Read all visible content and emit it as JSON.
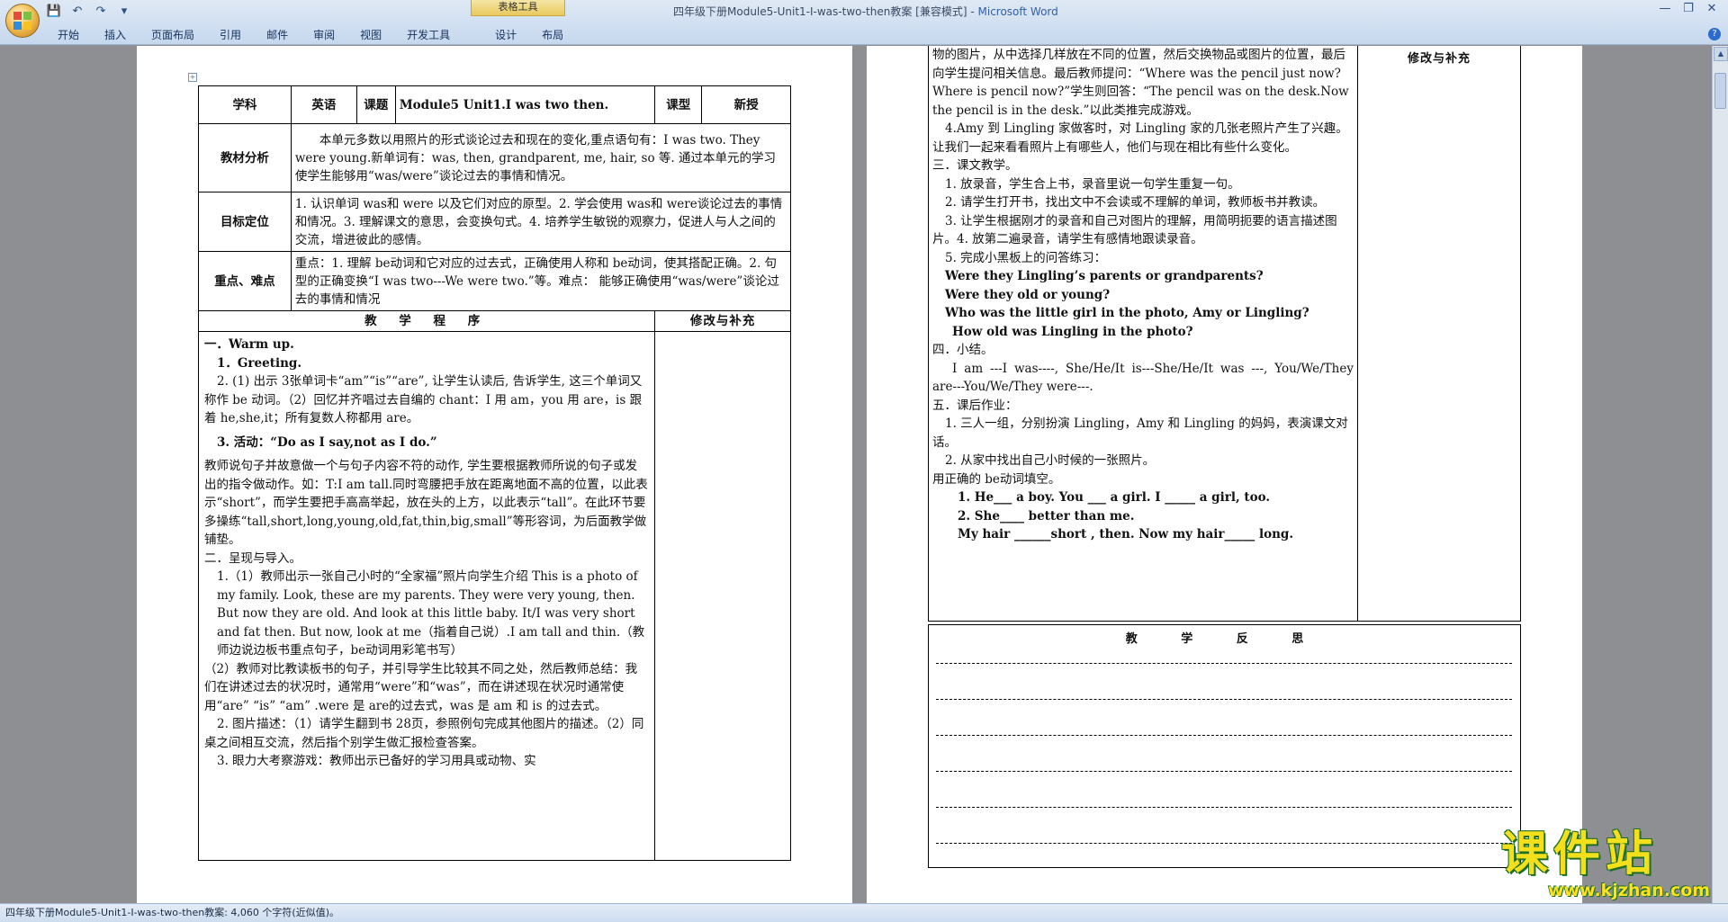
{
  "window": {
    "title": "四年级下册Module5-Unit1-I-was-two-then教案 [兼容模式]",
    "app_name": "Microsoft Word",
    "contextual_tab": "表格工具"
  },
  "ribbon": {
    "tabs": [
      "开始",
      "插入",
      "页面布局",
      "引用",
      "邮件",
      "审阅",
      "视图",
      "开发工具",
      "设计",
      "布局"
    ]
  },
  "quick_access": {
    "save": "💾",
    "undo": "↶",
    "redo": "↷",
    "customize": "▾"
  },
  "window_controls": {
    "minimize": "—",
    "restore": "❐",
    "close": "✕",
    "help": "?"
  },
  "table": {
    "subject_label": "学科",
    "subject_value": "英语",
    "topic_label": "课题",
    "topic_value": "Module5 Unit1.I was two then.",
    "type_label": "课型",
    "type_value": "新授",
    "analysis_label": "教材分析",
    "analysis_text": "本单元多数以用照片的形式谈论过去和现在的变化,重点语句有：I was two. They were young.新单词有：was, then, grandparent, me, hair, so 等. 通过本单元的学习使学生能够用“was/were”谈论过去的事情和情况。",
    "goal_label": "目标定位",
    "goal_text": "1. 认识单词 was和 were 以及它们对应的原型。2. 学会使用 was和 were谈论过去的事情和情况。3. 理解课文的意思，会变换句式。4. 培养学生敏锐的观察力，促进人与人之间的交流，增进彼此的感情。",
    "key_label": "重点、难点",
    "key_text": "重点：1. 理解 be动词和它对应的过去式，正确使用人称和 be动词，使其搭配正确。2. 句型的正确变换“I was two---We were two.”等。难点： 能够正确使用“was/were”谈论过去的事情和情况",
    "procedure_header": "教 学 程 序",
    "supplement_header": "修改与补充"
  },
  "procedure_left": [
    "一．Warm up.",
    "1．Greeting.",
    "2. (1) 出示 3张单词卡“am”“is”“are”, 让学生认读后, 告诉学生, 这三个单词又称作 be 动词。（2）回忆并齐唱过去自编的 chant：I 用 am，you 用 are，is 跟着 he,she,it；所有复数人称都用 are。",
    "3. 活动：“Do as I say,not as I do.”",
    "教师说句子并故意做一个与句子内容不符的动作, 学生要根据教师所说的句子或发出的指令做动作。如：T:I am tall.同时弯腰把手放在距离地面不高的位置，以此表示“short”，而学生要把手高高举起，放在头的上方，以此表示“tall”。在此环节要多操练“tall,short,long,young,old,fat,thin,big,small”等形容词，为后面教学做铺垫。",
    "二．呈现与导入。",
    "1.（1）教师出示一张自己小时的“全家福”照片向学生介绍 This is a photo of my family. Look, these are my parents. They were very young, then. But now they are old. And look at this little baby. It/I was very short and fat then. But now, look at me（指着自己说）.I am tall and thin.（教师边说边板书重点句子，be动词用彩笔书写）",
    "（2）教师对比教读板书的句子，并引导学生比较其不同之处，然后教师总结：我们在讲述过去的状况时，通常用“were”和“was”，而在讲述现在状况时通常使用“are” “is” “am” .were 是 are的过去式，was 是 am 和 is 的过去式。",
    "2. 图片描述：（1）请学生翻到书 28页，参照例句完成其他图片的描述。（2）同桌之间相互交流，然后指个别学生做汇报检查答案。",
    "3. 眼力大考察游戏：教师出示已备好的学习用具或动物、实"
  ],
  "procedure_right": [
    "物的图片，从中选择几样放在不同的位置，然后交换物品或图片的位置，最后向学生提问相关信息。最后教师提问：“Where was the pencil just now?Where is pencil now?”学生则回答：“The pencil was on the desk.Now the pencil is in the desk.”以此类推完成游戏。",
    "4.Amy 到 Lingling 家做客时，对 Lingling 家的几张老照片产生了兴趣。让我们一起来看看照片上有哪些人，他们与现在相比有些什么变化。",
    "三．课文教学。",
    "1. 放录音，学生合上书，录音里说一句学生重复一句。",
    "2. 请学生打开书，找出文中不会读或不理解的单词，教师板书并教读。",
    "3. 让学生根据刚才的录音和自己对图片的理解，用简明扼要的语言描述图片。4. 放第二遍录音，请学生有感情地跟读录音。",
    "5. 完成小黑板上的问答练习：",
    "Were they Lingling’s parents or grandparents?",
    "Were they old or young?",
    "Who was the little girl in the photo, Amy or Lingling?",
    "How old was Lingling in the photo?",
    "四．小结。",
    "I am ---I was----, She/He/It is---She/He/It was ---, You/We/They are---You/We/They were---.",
    "五．课后作业：",
    "1. 三人一组，分别扮演 Lingling，Amy 和 Lingling 的妈妈，表演课文对话。",
    "2. 从家中找出自己小时候的一张照片。",
    "用正确的 be动词填空。",
    "1. He___ a boy. You ___ a girl. I _____ a girl, too.",
    "2. She____ better than me.",
    "My hair ______short , then. Now my hair_____ long."
  ],
  "right_supplement_header": "修改与补充",
  "reflection_header": "教 学 反 思",
  "status_bar": "四年级下册Module5-Unit1-I-was-two-then教案: 4,060 个字符(近似值)。",
  "watermark": {
    "title": "课件站",
    "url": "www.kjzhan.com"
  },
  "colors": {
    "ribbon": "#c6d8ee",
    "workspace": "#8d8f92",
    "contextual_tab": "#e9c95d",
    "watermark": "#f4df1d"
  }
}
